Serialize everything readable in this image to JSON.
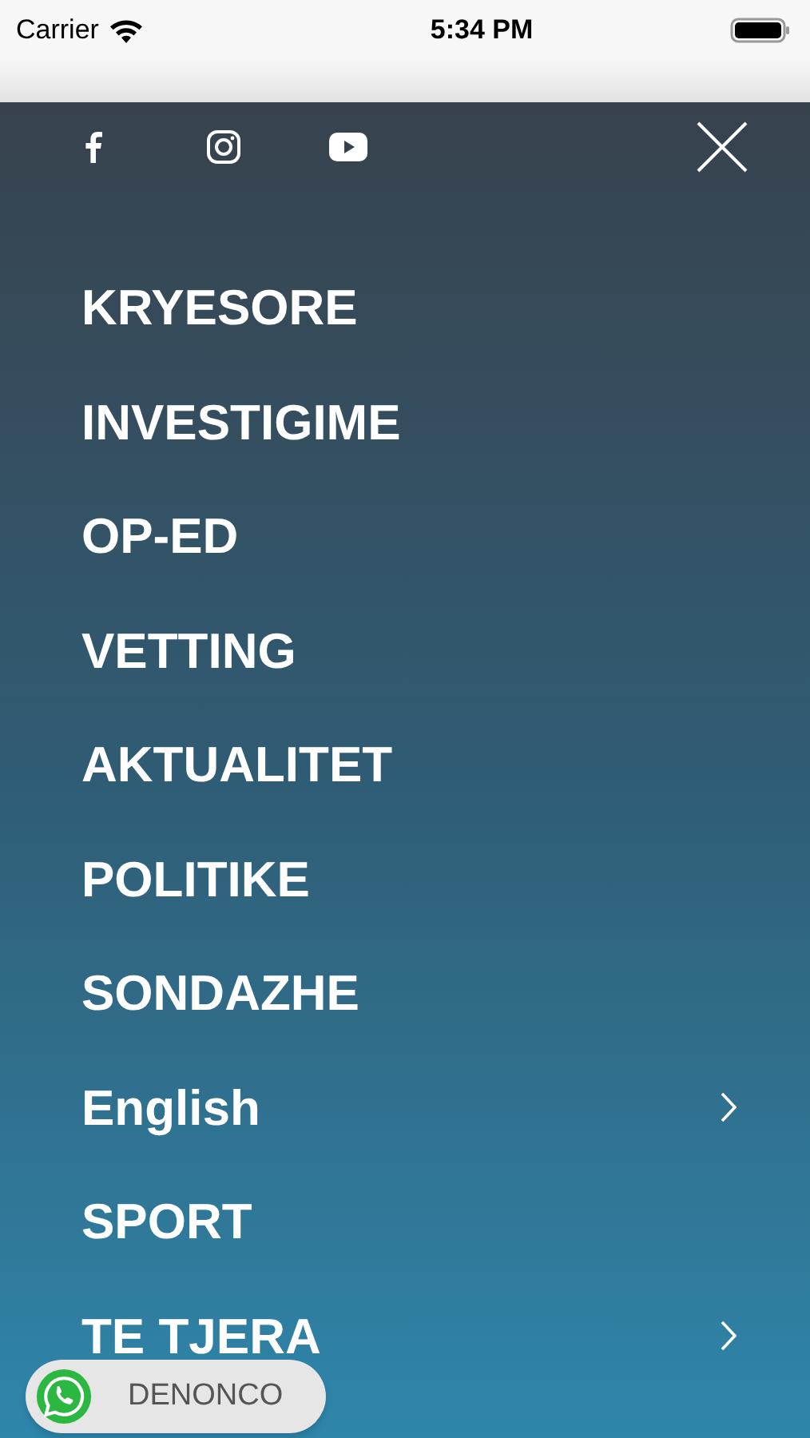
{
  "status_bar": {
    "carrier": "Carrier",
    "time": "5:34 PM"
  },
  "menu": {
    "items": [
      {
        "label": "KRYESORE",
        "has_submenu": false
      },
      {
        "label": "INVESTIGIME",
        "has_submenu": false
      },
      {
        "label": "OP-ED",
        "has_submenu": false
      },
      {
        "label": "VETTING",
        "has_submenu": false
      },
      {
        "label": "AKTUALITET",
        "has_submenu": false
      },
      {
        "label": "POLITIKE",
        "has_submenu": false
      },
      {
        "label": "SONDAZHE",
        "has_submenu": false
      },
      {
        "label": "English",
        "has_submenu": true
      },
      {
        "label": "SPORT",
        "has_submenu": false
      },
      {
        "label": "TE TJERA",
        "has_submenu": true
      }
    ]
  },
  "whatsapp_button": {
    "label": "DENONCO"
  }
}
